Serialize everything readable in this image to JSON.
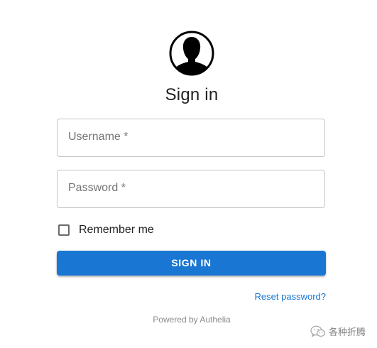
{
  "login": {
    "title": "Sign in",
    "username_label": "Username *",
    "password_label": "Password *",
    "remember_label": "Remember me",
    "remember_checked": false,
    "signin_label": "SIGN IN",
    "reset_label": "Reset password?",
    "powered_by": "Powered by Authelia"
  },
  "icons": {
    "avatar": "user-avatar-icon",
    "checkbox": "checkbox-unchecked-icon",
    "watermark": "wechat-icon"
  },
  "watermark": {
    "text": "各种折腾"
  },
  "colors": {
    "primary": "#1976d2",
    "text": "#222222",
    "muted": "#757575",
    "border": "#c4c4c4",
    "background": "#ffffff"
  }
}
